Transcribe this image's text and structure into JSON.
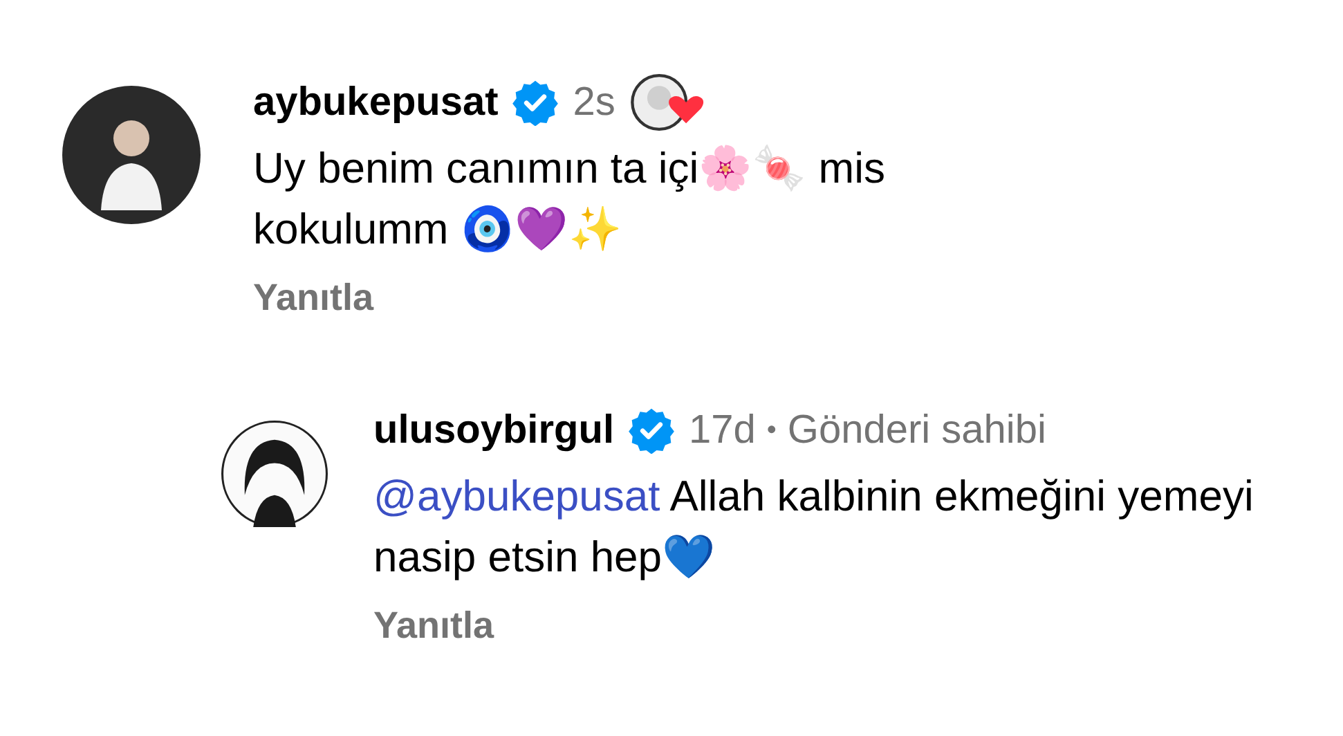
{
  "comments": [
    {
      "username": "aybukepusat",
      "verified": true,
      "time": "2s",
      "liked_by_author": true,
      "text": "Uy benim canımın ta içi🌸🍬 mis kokulumm 🧿💜✨",
      "reply_label": "Yanıtla",
      "replies": [
        {
          "username": "ulusoybirgul",
          "verified": true,
          "time": "17d",
          "separator": "•",
          "author_label": "Gönderi sahibi",
          "mention": "@aybukepusat",
          "text": "Allah kalbinin ekmeğini yemeyi nasip etsin hep💙",
          "reply_label": "Yanıtla"
        }
      ]
    }
  ]
}
